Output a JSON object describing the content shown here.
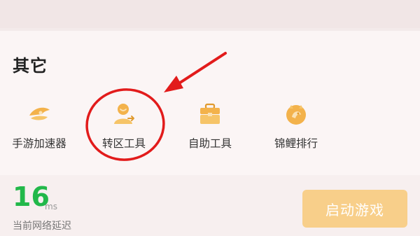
{
  "section": {
    "title": "其它"
  },
  "tools": [
    {
      "label": "手游加速器",
      "icon": "rocket-icon"
    },
    {
      "label": "转区工具",
      "icon": "user-transfer-icon"
    },
    {
      "label": "自助工具",
      "icon": "toolbox-icon"
    },
    {
      "label": "锦鲤排行",
      "icon": "koi-badge-icon"
    }
  ],
  "footer": {
    "latency_value": "16",
    "latency_unit": "ms",
    "latency_label": "当前网络延迟",
    "start_button_label": "启动游戏"
  },
  "colors": {
    "accent_orange": "#f3b24b",
    "latency_green": "#22b84a",
    "annotation_red": "#e21b1b",
    "start_button": "#f8cf8a"
  }
}
